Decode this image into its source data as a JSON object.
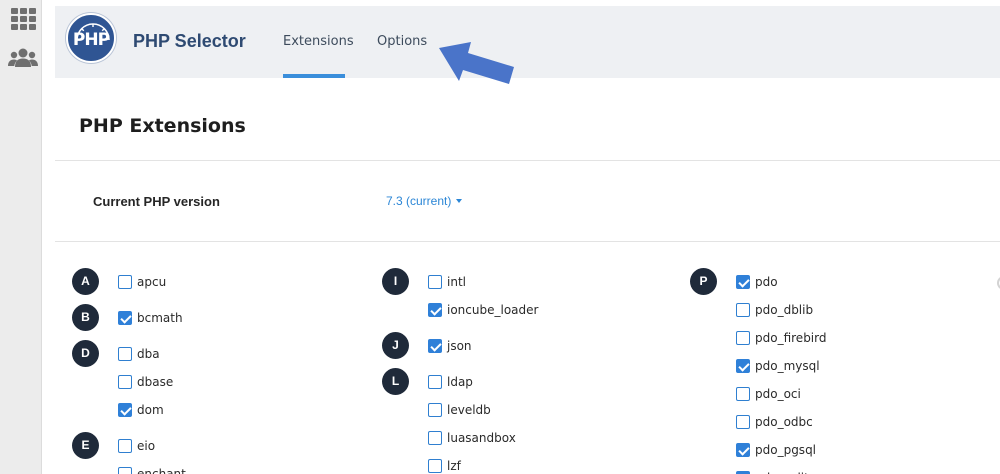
{
  "header": {
    "logo_text": "PHP",
    "title": "PHP Selector",
    "tabs": [
      {
        "label": "Extensions",
        "active": true
      },
      {
        "label": "Options",
        "active": false
      }
    ]
  },
  "page": {
    "title": "PHP Extensions",
    "version_label": "Current PHP version",
    "version_value": "7.3 (current)"
  },
  "icons": {
    "rail_top": "apps-grid-icon",
    "rail_users": "users-icon",
    "annotation": "pointer-arrow-icon"
  },
  "colors": {
    "accent": "#2f80d8",
    "title": "#2e4a72",
    "badge": "#1f2a3a",
    "arrow": "#4a74c9"
  },
  "extensions": {
    "columns": [
      {
        "rows": [
          {
            "letter": "A",
            "name": "apcu",
            "checked": false
          },
          {
            "letter": "B",
            "name": "bcmath",
            "checked": true
          },
          {
            "letter": "D",
            "name": "dba",
            "checked": false
          },
          {
            "letter": "",
            "name": "dbase",
            "checked": false
          },
          {
            "letter": "",
            "name": "dom",
            "checked": true
          },
          {
            "letter": "E",
            "name": "eio",
            "checked": false
          },
          {
            "letter": "",
            "name": "enchant",
            "checked": false
          }
        ]
      },
      {
        "rows": [
          {
            "letter": "I",
            "name": "intl",
            "checked": false
          },
          {
            "letter": "",
            "name": "ioncube_loader",
            "checked": true
          },
          {
            "letter": "J",
            "name": "json",
            "checked": true
          },
          {
            "letter": "L",
            "name": "ldap",
            "checked": false
          },
          {
            "letter": "",
            "name": "leveldb",
            "checked": false
          },
          {
            "letter": "",
            "name": "luasandbox",
            "checked": false
          },
          {
            "letter": "",
            "name": "lzf",
            "checked": false
          }
        ]
      },
      {
        "rows": [
          {
            "letter": "P",
            "name": "pdo",
            "checked": true
          },
          {
            "letter": "",
            "name": "pdo_dblib",
            "checked": false
          },
          {
            "letter": "",
            "name": "pdo_firebird",
            "checked": false
          },
          {
            "letter": "",
            "name": "pdo_mysql",
            "checked": true
          },
          {
            "letter": "",
            "name": "pdo_oci",
            "checked": false
          },
          {
            "letter": "",
            "name": "pdo_odbc",
            "checked": false
          },
          {
            "letter": "",
            "name": "pdo_pgsql",
            "checked": true
          },
          {
            "letter": "",
            "name": "pdo_sqlite",
            "checked": true
          }
        ]
      }
    ]
  }
}
